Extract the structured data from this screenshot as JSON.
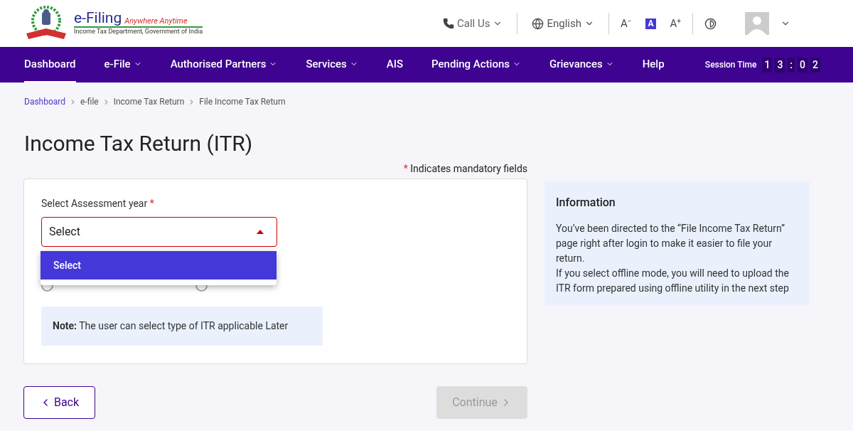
{
  "header": {
    "brand": "e-Filing",
    "tagline": "Anywhere Anytime",
    "department": "Income Tax Department, Government of India",
    "call_us": "Call Us",
    "language": "English",
    "font_controls": [
      {
        "label": "A",
        "mark": "−",
        "selected": false
      },
      {
        "label": "A",
        "selected": true
      },
      {
        "label": "A",
        "mark": "+",
        "selected": false
      }
    ]
  },
  "nav": {
    "items": [
      {
        "label": "Dashboard",
        "dropdown": false,
        "selected": true
      },
      {
        "label": "e-File",
        "dropdown": true,
        "selected": false
      },
      {
        "label": "Authorised Partners",
        "dropdown": true,
        "selected": false
      },
      {
        "label": "Services",
        "dropdown": true,
        "selected": false
      },
      {
        "label": "AIS",
        "dropdown": false,
        "selected": false
      },
      {
        "label": "Pending Actions",
        "dropdown": true,
        "selected": false
      },
      {
        "label": "Grievances",
        "dropdown": true,
        "selected": false
      },
      {
        "label": "Help",
        "dropdown": false,
        "selected": false
      }
    ],
    "session_label": "Session Time",
    "session_digits": [
      "1",
      "3",
      ":",
      "0",
      "2"
    ]
  },
  "breadcrumb": [
    "Dashboard",
    "e-file",
    "Income Tax Return",
    "File Income Tax Return"
  ],
  "title": "Income Tax Return (ITR)",
  "mandatory_note": "Indicates mandatory fields",
  "mandatory_mark": "*",
  "form": {
    "field_label": "Select Assessment year",
    "required": true,
    "select_value": "Select",
    "expanded": true,
    "options": [
      {
        "label": "Select",
        "selected": true
      }
    ],
    "mode_options": [
      {
        "kind": "radio",
        "selected": false
      },
      {
        "kind": "radio",
        "selected": false
      }
    ],
    "note_label": "Note:",
    "note_text": "The user can select type of ITR applicable Later"
  },
  "info": {
    "title": "Information",
    "lines": [
      "You’ve been directed to the “File Income Tax Return” page right after login to make it easier to file your return.",
      "If you select offline mode, you will need to upload the ITR form prepared using offline utility in the next step"
    ]
  },
  "buttons": {
    "back": "Back",
    "continue": "Continue",
    "continue_disabled": true
  }
}
